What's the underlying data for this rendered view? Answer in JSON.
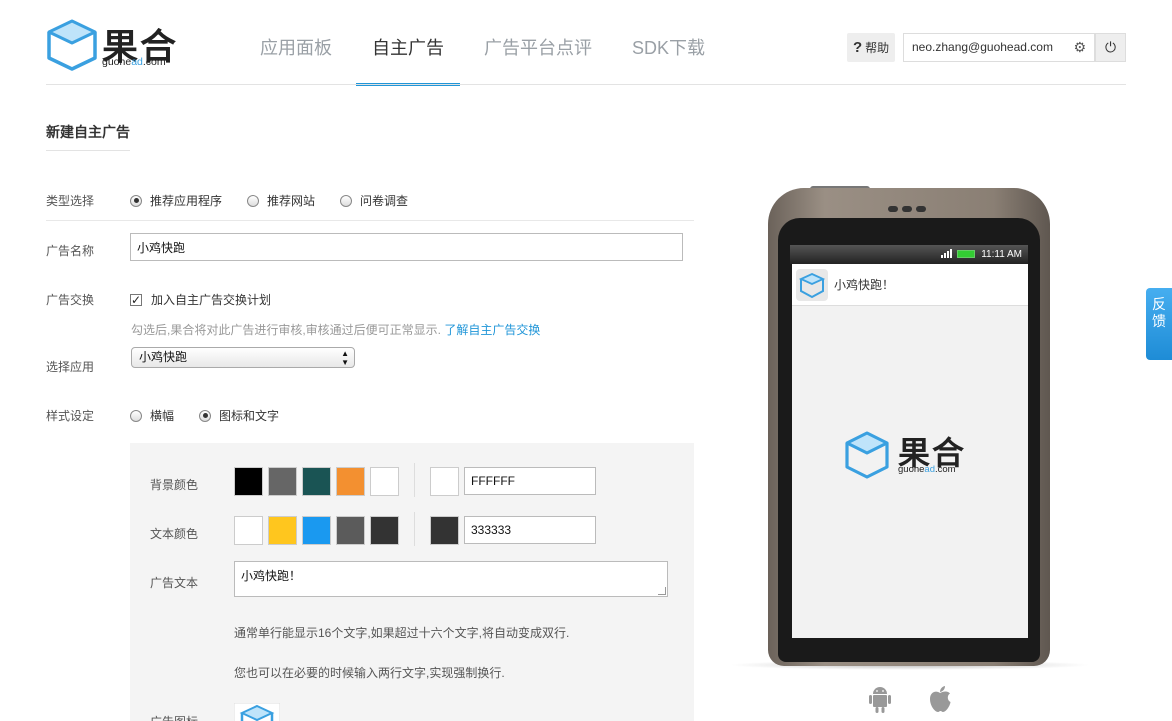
{
  "header": {
    "logo_brand": "果合",
    "logo_sub_pre": "guohe",
    "logo_sub_accent": "ad",
    "logo_sub_post": ".com",
    "nav": [
      {
        "label": "应用面板"
      },
      {
        "label": "自主广告"
      },
      {
        "label": "广告平台点评"
      },
      {
        "label": "SDK下载"
      }
    ],
    "help_icon": "?",
    "help_label": "帮助",
    "user_email": "neo.zhang@guohead.com",
    "gear_icon": "⚙",
    "power_icon": "⏻"
  },
  "page": {
    "title": "新建自主广告"
  },
  "form": {
    "type_label": "类型选择",
    "type_options": [
      "推荐应用程序",
      "推荐网站",
      "问卷调查"
    ],
    "name_label": "广告名称",
    "name_value": "小鸡快跑",
    "exchange_label": "广告交换",
    "exchange_checkbox_label": "加入自主广告交换计划",
    "exchange_checked": true,
    "exchange_hint": "勾选后,果合将对此广告进行审核,审核通过后便可正常显示.",
    "exchange_link": "了解自主广告交换",
    "app_label": "选择应用",
    "app_selected": "小鸡快跑",
    "style_label": "样式设定",
    "style_options": [
      "横幅",
      "图标和文字"
    ]
  },
  "style_panel": {
    "bg_label": "背景颜色",
    "bg_swatches": [
      "#000000",
      "#666666",
      "#1a5454",
      "#f39030",
      "#ffffff"
    ],
    "bg_current": "#ffffff",
    "bg_value": "FFFFFF",
    "text_label": "文本颜色",
    "text_swatches": [
      "#ffffff",
      "#ffc61e",
      "#1a99f0",
      "#5b5b5b",
      "#333333"
    ],
    "text_current": "#333333",
    "text_value": "333333",
    "ad_text_label": "广告文本",
    "ad_text_value": "小鸡快跑！",
    "note1": "通常单行能显示16个文字,如果超过十六个文字,将自动变成双行.",
    "note2": "您也可以在必要的时候输入两行文字,实现强制换行.",
    "icon_label": "广告图标"
  },
  "preview": {
    "time": "11:11 AM",
    "ad_text": "小鸡快跑！",
    "logo_brand": "果合",
    "logo_sub_pre": "guohe",
    "logo_sub_accent": "ad",
    "logo_sub_post": ".com"
  },
  "feedback": {
    "line1": "反",
    "line2": "馈"
  }
}
